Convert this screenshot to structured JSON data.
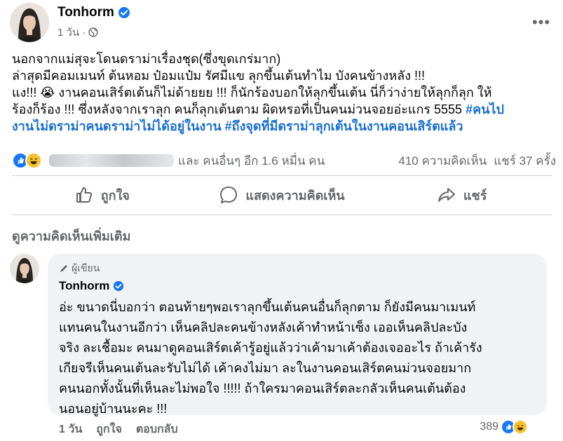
{
  "post": {
    "author": "Tonhorm",
    "time": "1 วัน",
    "separator": "·",
    "more_label": "•••",
    "text_lines": [
      "นอกจากแม่สุจะโดนดราม่าเรื่องชุด(ซึ่งขุดเกร่มาก)",
      "ล่าสุดมีคอมเมนท์ ต้นหอม ป๋อมแป๋ม รัศมีแข ลุกขึ้นเต้นทำไม บังคนข้างหลัง !!!",
      "แง!!! 😭 งานคอนเสิร์ตเต้นก็ไม่ด้ายยย !!! ก็นักร้องบอกให้ลุกขึ้นเต้น นี่ก็ว่าง่ายให้ลุกก็ลุก ให้",
      "ร้องก็ร้อง !!! ซึ่งหลังจากเราลุก คนก็ลุกเต้นตาม  ผิดหรอที่เป็นคนม่วนจอยอ่ะแกร 5555 "
    ],
    "hashtag_1": "#คนไป",
    "hashtag_line": "งานไม่ดราม่าคนดราม่าไม่ได้อยู่ในงาน #ถึงจุดที่มีดราม่าลุกเต้นในงานคอนเสิร์ตแล้ว"
  },
  "reactions": {
    "others_text": "และ คนอื่นๆ อีก 1.6 หมื่น คน",
    "comments_count": "410 ความคิดเห็น",
    "shares_count": "แชร์ 37 ครั้ง"
  },
  "actions": {
    "like": "ถูกใจ",
    "comment": "แสดงความคิดเห็น",
    "share": "แชร์"
  },
  "comments_section": {
    "more_comments": "ดูความคิดเห็นเพิ่มเติม",
    "comment": {
      "badge": "ผู้เขียน",
      "author": "Tonhorm",
      "lines": [
        "อ่ะ ขนาดนี่บอกว่า ตอนท้ายๆพอเราลุกขึ้นเต้นคนอื่นก็ลุกตาม ก็ยังมีคนมาเมนท์",
        "แทนคนในงานอีกว่า เห็นคลิปละคนข้างหลังเค้าทำหน้าเซ็ง เออเห็นคลิปละบัง",
        "จริง ละเชื้อมะ คนมาดูคอนเสิร์ตเค้ารู้อยู่แล้วว่าเค้ามาเค้าต้องเจออะไร ถ้าเค้ารัง",
        "เกียจรีเห็นคนเต้นละรับไม่ได้ เค้าคงไม่มา ละในงานคอนเสิร์ตคนม่วนจอยมาก",
        "คนนอกทั้งนั้นที่เห็นละไม่พอใจ !!!!! ถ้าใครมาคอนเสิร์ตละกลัวเห็นคนเต้นต้อง",
        "นอนอยู่บ้านนะคะ !!!"
      ],
      "time": "1 วัน",
      "like": "ถูกใจ",
      "reply": "ตอบกลับ",
      "reaction_count": "389"
    }
  },
  "colors": {
    "accent": "#1877f2",
    "hashtag": "#1b6fd1",
    "secondary_text": "#65676b",
    "bubble": "#f0f2f5"
  }
}
